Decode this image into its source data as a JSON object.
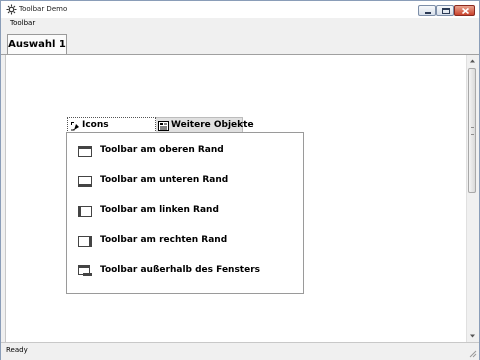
{
  "window": {
    "title": "Toolbar Demo",
    "icon": "gear-app-icon",
    "buttons": [
      "minimize-icon",
      "maximize-icon",
      "close-icon"
    ],
    "close_color": "#c9432c"
  },
  "menubar": {
    "items": [
      "Toolbar"
    ]
  },
  "tabs": {
    "active": "Auswahl 1"
  },
  "panel": {
    "tabs": [
      {
        "label": "Icons",
        "icon": "cursor-icon",
        "selected": true
      },
      {
        "label": "Weitere Objekte",
        "icon": "objects-icon",
        "selected": false
      }
    ],
    "items": [
      {
        "label": "Toolbar am oberen Rand",
        "icon": "toolbar-top-icon"
      },
      {
        "label": "Toolbar am unteren Rand",
        "icon": "toolbar-bottom-icon"
      },
      {
        "label": "Toolbar am linken Rand",
        "icon": "toolbar-left-icon"
      },
      {
        "label": "Toolbar am rechten Rand",
        "icon": "toolbar-right-icon"
      },
      {
        "label": "Toolbar außerhalb des Fensters",
        "icon": "toolbar-outside-icon"
      }
    ]
  },
  "statusbar": {
    "text": "Ready"
  }
}
